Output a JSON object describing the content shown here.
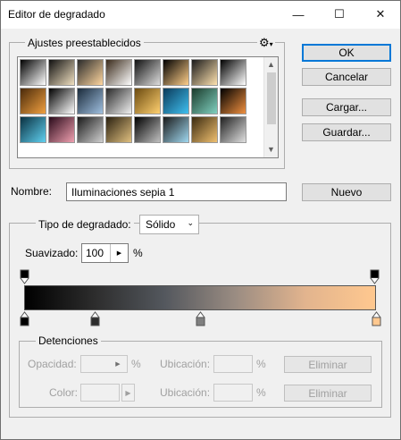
{
  "window": {
    "title": "Editor de degradado",
    "minimize_glyph": "—",
    "maximize_glyph": "☐",
    "close_glyph": "✕"
  },
  "presets": {
    "label": "Ajustes preestablecidos",
    "gear_glyph": "⚙",
    "swatches": [
      [
        "#000000,#ffffff",
        "#101010,#f0e0c0",
        "#2a2a2a,#ffd7a0",
        "#3a2a1a,#ffffff",
        "#111111,#dddddd",
        "#000000,#ffcf8a",
        "#1a1a1a,#ffe3b0",
        "#000000,#ffffff"
      ],
      [
        "#4a2a0a,#f0a040",
        "#000000,#ffffff",
        "#1a2a3a,#a0c0e0",
        "#2a2a2a,#f0f0f0",
        "#6a4a10,#ffd070",
        "#0a3a5a,#40c0f0",
        "#1a3a2a,#80d0c0",
        "#000000,#f09040"
      ],
      [
        "#0a3040,#60d0f0",
        "#2a0a1a,#f0a0b0",
        "#1a1a1a,#d0d0d0",
        "#2a2010,#e0c080",
        "#000000,#c0c0c0",
        "#1a1a1a,#a0d8f0",
        "#3a2a10,#f0c070",
        "#202020,#e0e0e0"
      ]
    ]
  },
  "buttons": {
    "ok": "OK",
    "cancel": "Cancelar",
    "load": "Cargar...",
    "save": "Guardar..."
  },
  "name": {
    "label": "Nombre:",
    "value": "Iluminaciones sepia 1",
    "new_button": "Nuevo"
  },
  "gradient_type": {
    "label": "Tipo de degradado:",
    "value": "Sólido"
  },
  "smoothness": {
    "label": "Suavizado:",
    "value": "100",
    "unit": "%"
  },
  "gradient": {
    "colors": [
      "#000000",
      "#2d2d2d",
      "#54585e",
      "#9a8c82",
      "#e2b48e",
      "#ffc88f"
    ],
    "color_stops": [
      0.0,
      0.2,
      0.5,
      1.0
    ]
  },
  "stops_group": {
    "label": "Detenciones",
    "opacity_label": "Opacidad:",
    "opacity_unit": "%",
    "location_label_1": "Ubicación:",
    "location_unit_1": "%",
    "delete_1": "Eliminar",
    "color_label": "Color:",
    "location_label_2": "Ubicación:",
    "location_unit_2": "%",
    "delete_2": "Eliminar"
  }
}
